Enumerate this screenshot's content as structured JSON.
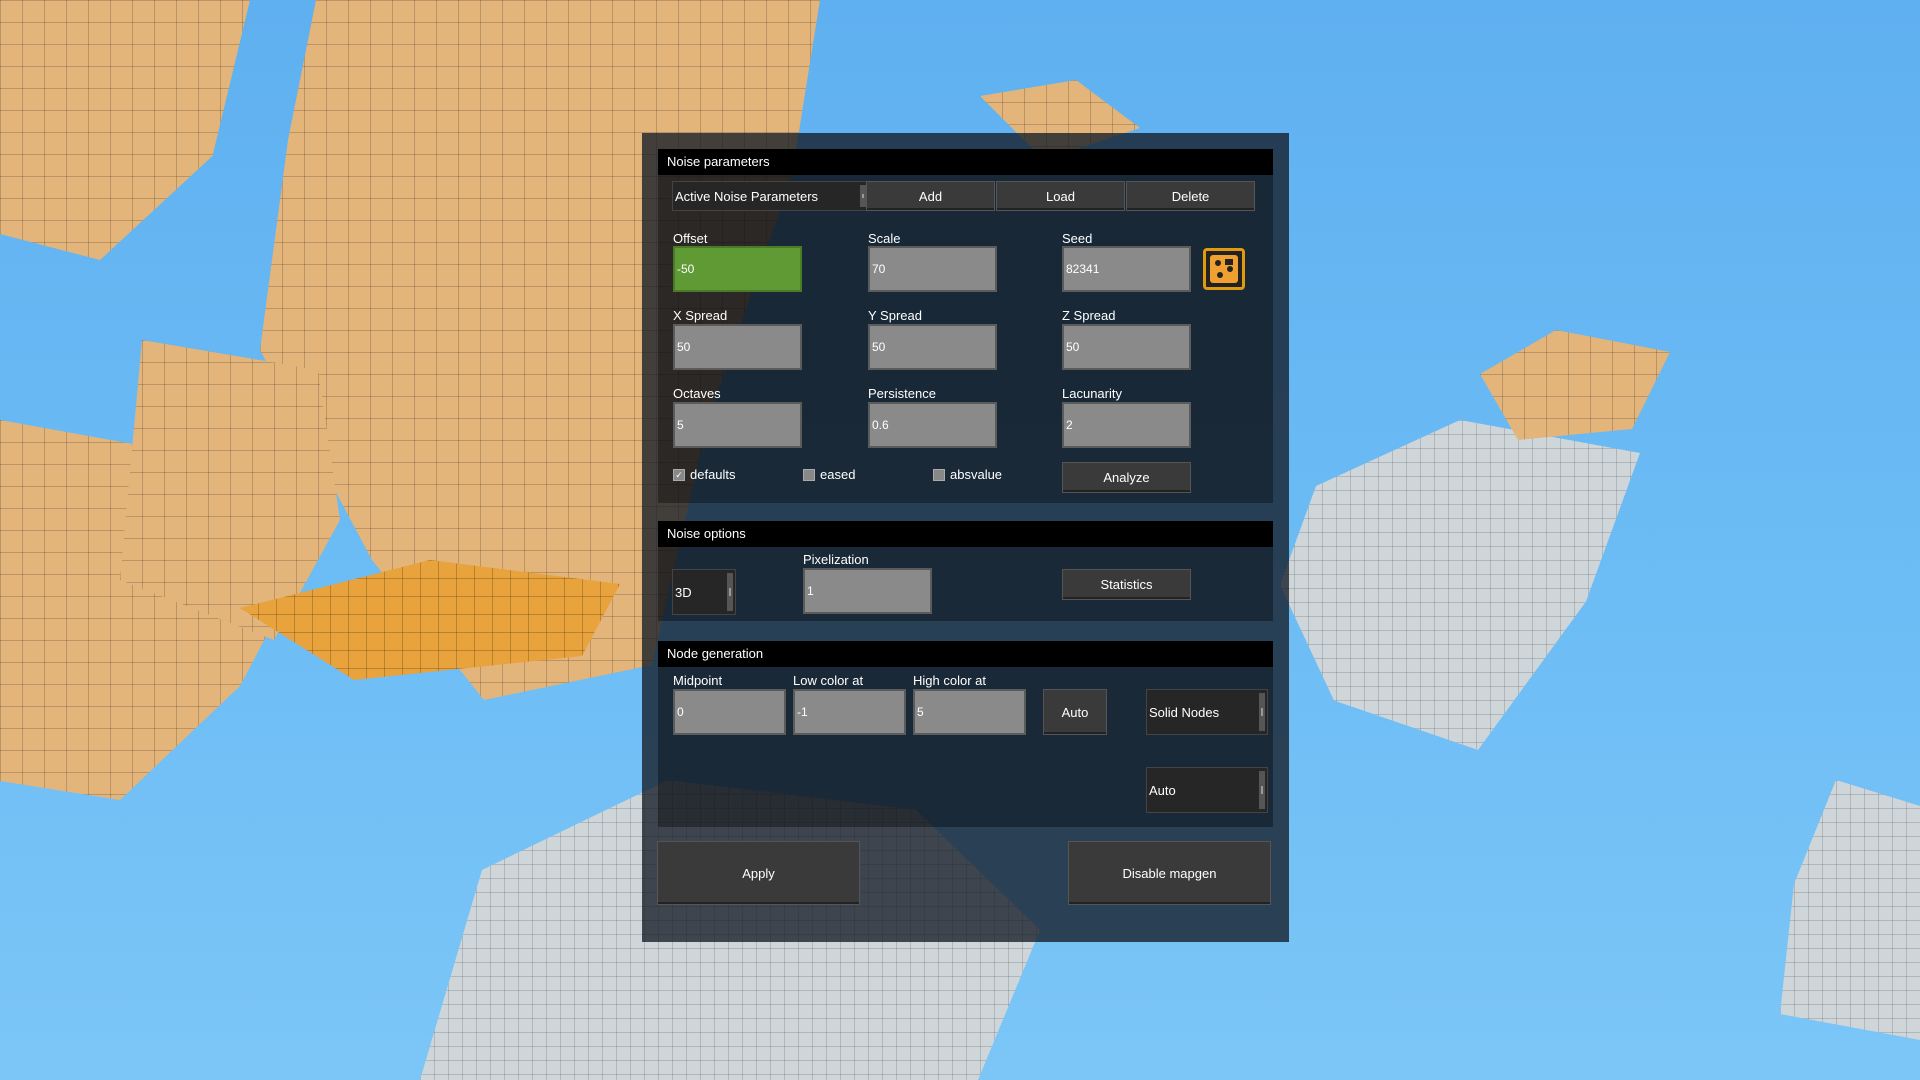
{
  "noise_parameters": {
    "header": "Noise parameters",
    "active_params_select": "Active Noise Parameters",
    "add_label": "Add",
    "load_label": "Load",
    "delete_label": "Delete",
    "fields": {
      "offset": {
        "label": "Offset",
        "value": "-50"
      },
      "scale": {
        "label": "Scale",
        "value": "70"
      },
      "seed": {
        "label": "Seed",
        "value": "82341"
      },
      "x_spread": {
        "label": "X Spread",
        "value": "50"
      },
      "y_spread": {
        "label": "Y Spread",
        "value": "50"
      },
      "z_spread": {
        "label": "Z Spread",
        "value": "50"
      },
      "octaves": {
        "label": "Octaves",
        "value": "5"
      },
      "persistence": {
        "label": "Persistence",
        "value": "0.6"
      },
      "lacunarity": {
        "label": "Lacunarity",
        "value": "2"
      }
    },
    "flags": [
      {
        "label": "defaults",
        "checked": true
      },
      {
        "label": "eased",
        "checked": false
      },
      {
        "label": "absvalue",
        "checked": false
      }
    ],
    "analyze_label": "Analyze",
    "seed_icon": "dice-icon"
  },
  "noise_options": {
    "header": "Noise options",
    "dimension_select": "3D",
    "pixelization_label": "Pixelization",
    "pixelization_value": "1",
    "statistics_label": "Statistics"
  },
  "node_generation": {
    "header": "Node generation",
    "midpoint_label": "Midpoint",
    "midpoint_value": "0",
    "low_color_label": "Low color at",
    "low_color_value": "-1",
    "high_color_label": "High color at",
    "high_color_value": "5",
    "auto_button_label": "Auto",
    "node_type_select": "Solid Nodes",
    "color_mode_select": "Auto"
  },
  "footer": {
    "apply_label": "Apply",
    "disable_label": "Disable mapgen"
  },
  "colors": {
    "active_field": "#5f9a35",
    "field": "#8a8a8a",
    "seed_icon_border": "#e09a10",
    "sky": "#6ab8f2"
  }
}
